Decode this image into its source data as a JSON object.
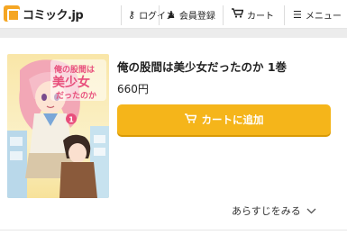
{
  "header": {
    "logo_text": "コミック.jp",
    "nav": {
      "login_label": "ログイン",
      "signup_label": "会員登録",
      "cart_label": "カート",
      "menu_label": "メニュー"
    }
  },
  "product": {
    "title": "俺の股間は美少女だったのか 1巻",
    "price": "660円",
    "add_to_cart_label": "カートに追加",
    "synopsis_label": "あらすじをみる"
  },
  "cover_art": {
    "title_text": "俺の股間は美少女だったのか",
    "volume_number": "1"
  },
  "colors": {
    "accent": "#f5b51a",
    "logo": "#f5a623"
  }
}
